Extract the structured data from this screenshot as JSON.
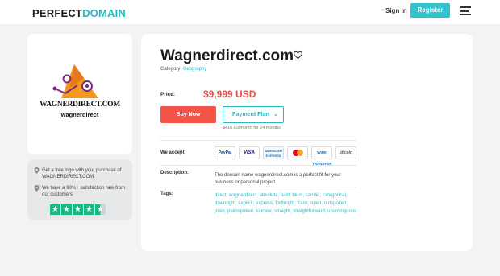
{
  "header": {
    "logo_part1": "PERFECT",
    "logo_part2": "DOMAIN",
    "signin_label": "Sign In",
    "register_label": "Register",
    "menu_icon": "hamburger-menu-icon"
  },
  "brand": {
    "wordmark": "WAGNERDIRECT.COM",
    "subtitle": "wagnerdirect"
  },
  "promo": {
    "items": [
      "Get a free logo with your purchase of WAGNERDIRECT.COM",
      "We have a 90%+ satisfaction rate from our customers"
    ],
    "rating_stars": 4.5
  },
  "listing": {
    "domain": "Wagnerdirect.com",
    "category_label": "Category:",
    "category_value": "Geography",
    "price_label": "Price:",
    "price_value": "$9,999 USD",
    "buy_label": "Buy Now",
    "plan_label": "Payment Plan",
    "plan_note": "$416.63/month for 24 months",
    "accept_label": "We accept:",
    "payment_methods": [
      "PayPal",
      "VISA",
      "AMERICAN EXPRESS",
      "Mastercard",
      "WIRE TRANSFER",
      "bitcoin"
    ],
    "description_label": "Description:",
    "description_text": "The domain name wagnerdirect.com is a perfect fit for your business or personal project.",
    "tags_label": "Tags:",
    "tags": [
      "direct",
      "wagnerdirect",
      "absolute",
      "bald",
      "blunt",
      "candid",
      "categorical",
      "downright",
      "explicit",
      "express",
      "forthright",
      "frank",
      "open",
      "outspoken",
      "plain",
      "plainspoken",
      "sincere",
      "straight",
      "straightforward",
      "unambiguous"
    ]
  },
  "colors": {
    "accent": "#2bb7c4",
    "price": "#f04a45",
    "buy_button": "#f25448",
    "star": "#1db880"
  }
}
